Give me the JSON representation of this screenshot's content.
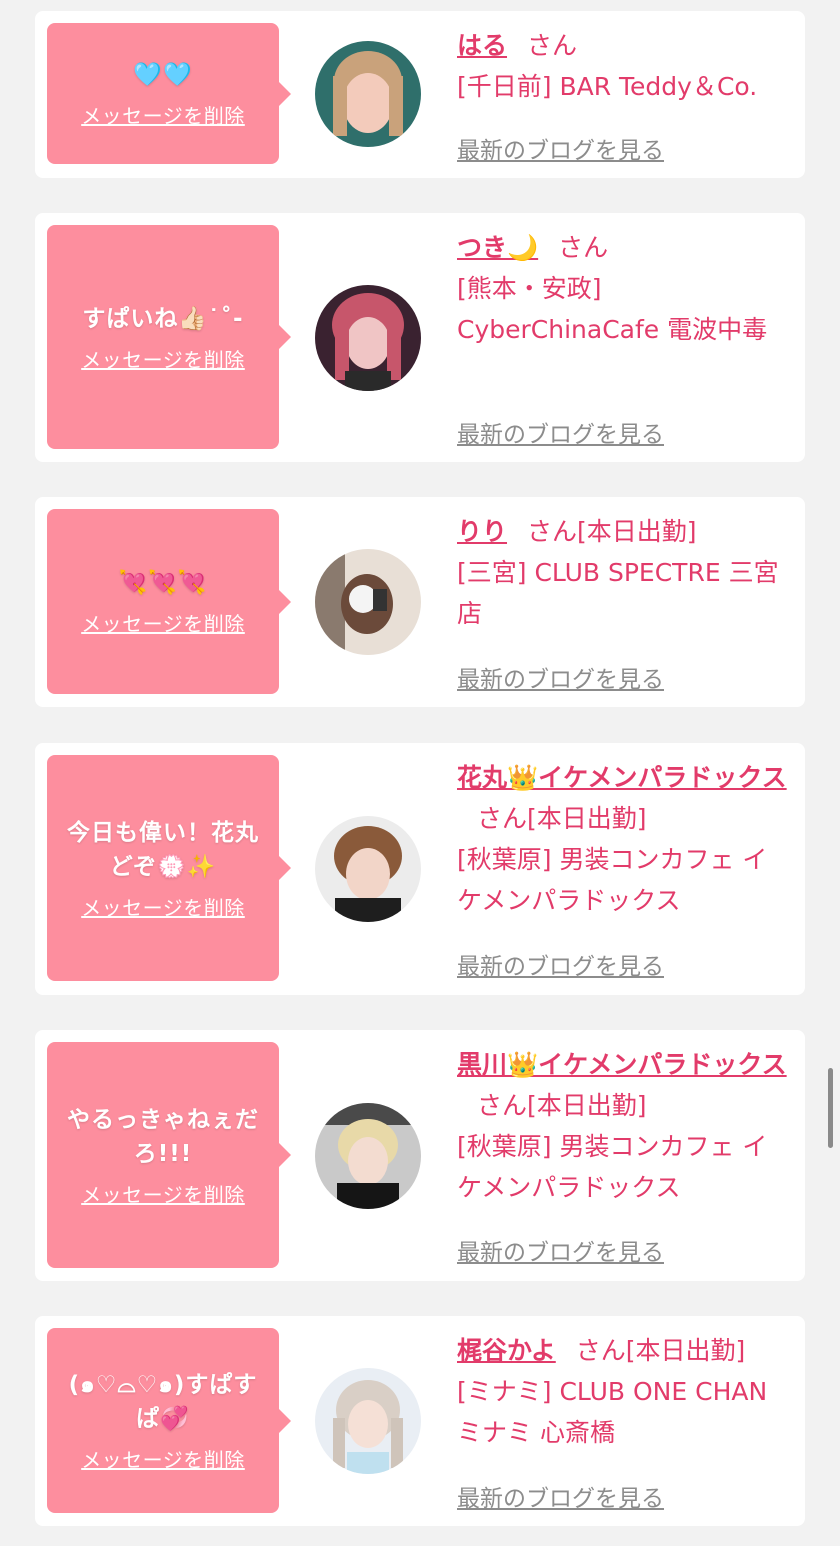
{
  "cards": [
    {
      "message": "🩵🩵",
      "delete_label": "メッセージを削除",
      "name": "はる",
      "honorific": "さん",
      "status": "",
      "shop": "[千日前] BAR Teddy＆Co.",
      "blog_label": "最新のブログを見る"
    },
    {
      "message": "すぱいね👍🏻˙˚-",
      "delete_label": "メッセージを削除",
      "name": "つき🌙",
      "honorific": "さん",
      "status": "",
      "shop": "[熊本・安政] CyberChinaCafe 電波中毒",
      "blog_label": "最新のブログを見る"
    },
    {
      "message": "💘💘💘",
      "delete_label": "メッセージを削除",
      "name": "りり",
      "honorific": "さん",
      "status": "[本日出勤]",
      "shop": "[三宮] CLUB SPECTRE 三宮店",
      "blog_label": "最新のブログを見る"
    },
    {
      "message": "今日も偉い！花丸どぞ💮✨",
      "delete_label": "メッセージを削除",
      "name": "花丸👑イケメンパラドックス",
      "honorific": "さん",
      "status": "[本日出勤]",
      "shop": "[秋葉原] 男装コンカフェ イケメンパラドックス",
      "blog_label": "最新のブログを見る"
    },
    {
      "message": "やるっきゃねぇだろ!!!",
      "delete_label": "メッセージを削除",
      "name": "黒川👑イケメンパラドックス",
      "honorific": "さん",
      "status": "[本日出勤]",
      "shop": "[秋葉原] 男装コンカフェ イケメンパラドックス",
      "blog_label": "最新のブログを見る"
    },
    {
      "message": "(๑♡⌓♡๑)すぱすぱ💞",
      "delete_label": "メッセージを削除",
      "name": "梶谷かよ",
      "honorific": "さん",
      "status": "[本日出勤]",
      "shop": "[ミナミ] CLUB ONE CHAN ミナミ 心斎橋",
      "blog_label": "最新のブログを見る"
    }
  ],
  "colors": {
    "accent": "#e23b6a",
    "bubble": "#fd8e9e",
    "link_gray": "#8c8c8c",
    "background": "#f2f2f2"
  }
}
